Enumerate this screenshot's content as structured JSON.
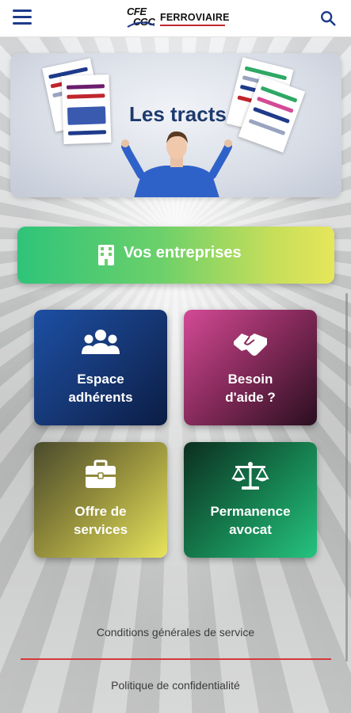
{
  "header": {
    "logo_mark_line1": "CFE",
    "logo_mark_line2": "CGC",
    "logo_text": "FERROVIAIRE",
    "menu_icon": "hamburger-menu-icon",
    "search_icon": "search-icon"
  },
  "banner": {
    "title": "Les tracts"
  },
  "entreprises": {
    "label": "Vos entreprises",
    "icon": "building-icon"
  },
  "tiles": [
    {
      "line1": "Espace",
      "line2": "adhérents",
      "icon": "users-group-icon"
    },
    {
      "line1": "Besoin",
      "line2": "d'aide ?",
      "icon": "handshake-icon"
    },
    {
      "line1": "Offre de",
      "line2": "services",
      "icon": "briefcase-icon"
    },
    {
      "line1": "Permanence",
      "line2": "avocat",
      "icon": "scales-icon"
    }
  ],
  "footer": {
    "cgs": "Conditions générales de service",
    "privacy": "Politique de confidentialité"
  },
  "colors": {
    "primary_blue": "#1e3a8a",
    "divider_red": "#d43a3a"
  }
}
